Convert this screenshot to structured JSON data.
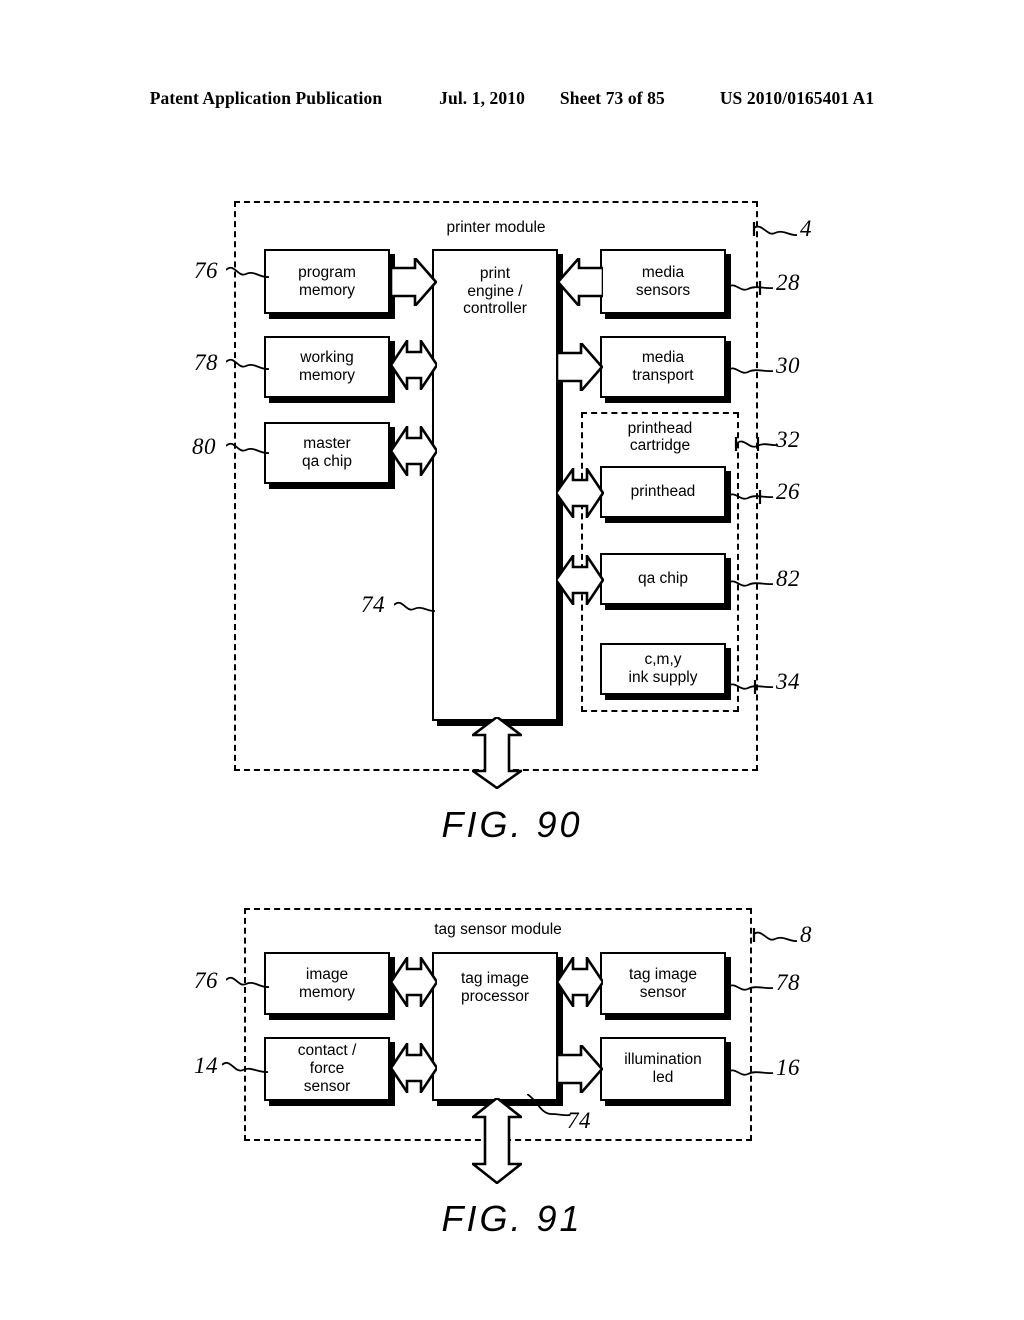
{
  "header": {
    "publication": "Patent Application Publication",
    "date": "Jul. 1, 2010",
    "sheet": "Sheet 73 of 85",
    "patent_number": "US 2010/0165401 A1"
  },
  "figures": [
    {
      "caption": "FIG. 90",
      "module_title": "printer module",
      "module_ref": "4",
      "nested_module_title": "printhead\ncartridge",
      "nested_module_ref": "32",
      "bus_ref": "74",
      "blocks": [
        {
          "label": "program\nmemory",
          "ref": "76",
          "side": "left"
        },
        {
          "label": "working\nmemory",
          "ref": "78",
          "side": "left"
        },
        {
          "label": "master\nqa chip",
          "ref": "80",
          "side": "left"
        },
        {
          "label": "print\nengine /\ncontroller",
          "ref": "74",
          "side": "center"
        },
        {
          "label": "media\nsensors",
          "ref": "28",
          "side": "right"
        },
        {
          "label": "media\ntransport",
          "ref": "30",
          "side": "right"
        },
        {
          "label": "printhead",
          "ref": "26",
          "side": "right"
        },
        {
          "label": "qa chip",
          "ref": "82",
          "side": "right"
        },
        {
          "label": "c,m,y\nink supply",
          "ref": "34",
          "side": "right"
        }
      ]
    },
    {
      "caption": "FIG. 91",
      "module_title": "tag sensor module",
      "module_ref": "8",
      "bus_ref": "74",
      "blocks": [
        {
          "label": "image\nmemory",
          "ref": "76",
          "side": "left"
        },
        {
          "label": "contact /\nforce\nsensor",
          "ref": "14",
          "side": "left"
        },
        {
          "label": "tag image\nprocessor",
          "ref": "74",
          "side": "center"
        },
        {
          "label": "tag image\nsensor",
          "ref": "78",
          "side": "right"
        },
        {
          "label": "illumination\nled",
          "ref": "16",
          "side": "right"
        }
      ]
    }
  ]
}
